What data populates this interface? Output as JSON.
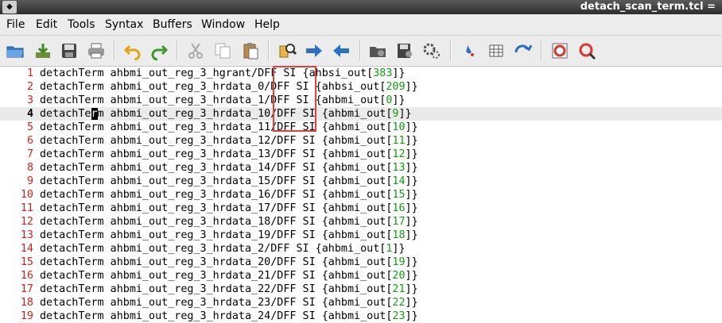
{
  "titlebar": {
    "app_icon": "gvim-icon",
    "title": "detach_scan_term.tcl ="
  },
  "menu": [
    "File",
    "Edit",
    "Tools",
    "Syntax",
    "Buffers",
    "Window",
    "Help"
  ],
  "toolbar": {
    "icons": [
      "open-folder-icon",
      "save-download-icon",
      "save-disk-icon",
      "print-icon",
      "undo-icon",
      "redo-icon",
      "cut-icon",
      "copy-icon",
      "paste-icon",
      "find-replace-icon",
      "forward-arrow-icon",
      "back-arrow-icon",
      "load-session-icon",
      "save-session-icon",
      "run-script-icon",
      "make-icon",
      "table-icon",
      "jump-tag-icon",
      "help-icon",
      "find-help-icon"
    ]
  },
  "editor": {
    "current_line": 4,
    "lines": [
      {
        "n": "1",
        "pre": "detachTerm ahbmi_out_reg_3_hgrant/DFF SI {ahbsi_out[",
        "num": "383",
        "post": "]}"
      },
      {
        "n": "2",
        "pre": "detachTerm ahbmi_out_reg_3_hrdata_0/DFF SI {ahbsi_out[",
        "num": "209",
        "post": "]}"
      },
      {
        "n": "3",
        "pre": "detachTerm ahbmi_out_reg_3_hrdata_1/DFF SI {ahbmi_out[",
        "num": "0",
        "post": "]}"
      },
      {
        "n": "4",
        "pre": "detachTerm ahbmi_out_reg_3_hrdata_10/DFF SI {ahbmi_out[",
        "num": "9",
        "post": "]}"
      },
      {
        "n": "5",
        "pre": "detachTerm ahbmi_out_reg_3_hrdata_11/DFF SI {ahbmi_out[",
        "num": "10",
        "post": "]}"
      },
      {
        "n": "6",
        "pre": "detachTerm ahbmi_out_reg_3_hrdata_12/DFF SI {ahbmi_out[",
        "num": "11",
        "post": "]}"
      },
      {
        "n": "7",
        "pre": "detachTerm ahbmi_out_reg_3_hrdata_13/DFF SI {ahbmi_out[",
        "num": "12",
        "post": "]}"
      },
      {
        "n": "8",
        "pre": "detachTerm ahbmi_out_reg_3_hrdata_14/DFF SI {ahbmi_out[",
        "num": "13",
        "post": "]}"
      },
      {
        "n": "9",
        "pre": "detachTerm ahbmi_out_reg_3_hrdata_15/DFF SI {ahbmi_out[",
        "num": "14",
        "post": "]}"
      },
      {
        "n": "10",
        "pre": "detachTerm ahbmi_out_reg_3_hrdata_16/DFF SI {ahbmi_out[",
        "num": "15",
        "post": "]}"
      },
      {
        "n": "11",
        "pre": "detachTerm ahbmi_out_reg_3_hrdata_17/DFF SI {ahbmi_out[",
        "num": "16",
        "post": "]}"
      },
      {
        "n": "12",
        "pre": "detachTerm ahbmi_out_reg_3_hrdata_18/DFF SI {ahbmi_out[",
        "num": "17",
        "post": "]}"
      },
      {
        "n": "13",
        "pre": "detachTerm ahbmi_out_reg_3_hrdata_19/DFF SI {ahbmi_out[",
        "num": "18",
        "post": "]}"
      },
      {
        "n": "14",
        "pre": "detachTerm ahbmi_out_reg_3_hrdata_2/DFF SI {ahbmi_out[",
        "num": "1",
        "post": "]}"
      },
      {
        "n": "15",
        "pre": "detachTerm ahbmi_out_reg_3_hrdata_20/DFF SI {ahbmi_out[",
        "num": "19",
        "post": "]}"
      },
      {
        "n": "16",
        "pre": "detachTerm ahbmi_out_reg_3_hrdata_21/DFF SI {ahbmi_out[",
        "num": "20",
        "post": "]}"
      },
      {
        "n": "17",
        "pre": "detachTerm ahbmi_out_reg_3_hrdata_22/DFF SI {ahbmi_out[",
        "num": "21",
        "post": "]}"
      },
      {
        "n": "18",
        "pre": "detachTerm ahbmi_out_reg_3_hrdata_23/DFF SI {ahbmi_out[",
        "num": "22",
        "post": "]}"
      },
      {
        "n": "19",
        "pre": "detachTerm ahbmi_out_reg_3_hrdata_24/DFF SI {ahbmi_out[",
        "num": "23",
        "post": "]}"
      }
    ]
  },
  "colors": {
    "line_number": "#d21f1f",
    "number_literal": "#119c11",
    "annotation_box": "#e04040",
    "current_line_bg": "#eaeaea"
  }
}
